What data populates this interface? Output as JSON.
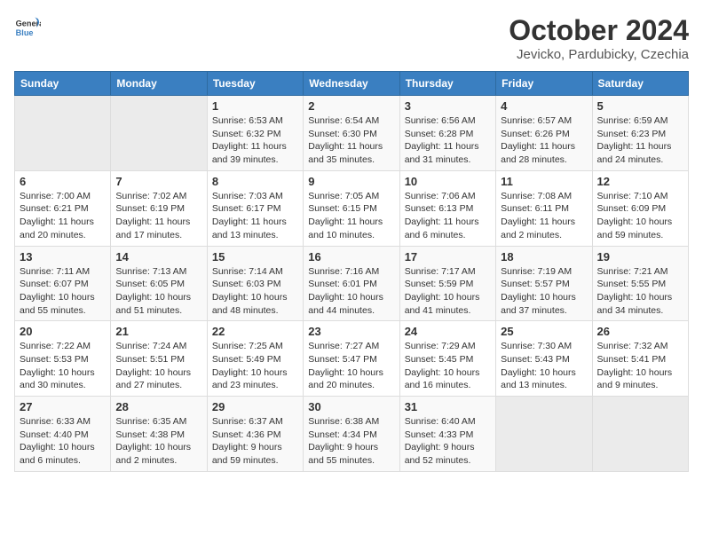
{
  "logo": {
    "line1": "General",
    "line2": "Blue"
  },
  "title": "October 2024",
  "subtitle": "Jevicko, Pardubicky, Czechia",
  "days_of_week": [
    "Sunday",
    "Monday",
    "Tuesday",
    "Wednesday",
    "Thursday",
    "Friday",
    "Saturday"
  ],
  "weeks": [
    [
      null,
      null,
      {
        "day": "1",
        "sunrise": "Sunrise: 6:53 AM",
        "sunset": "Sunset: 6:32 PM",
        "daylight": "Daylight: 11 hours and 39 minutes."
      },
      {
        "day": "2",
        "sunrise": "Sunrise: 6:54 AM",
        "sunset": "Sunset: 6:30 PM",
        "daylight": "Daylight: 11 hours and 35 minutes."
      },
      {
        "day": "3",
        "sunrise": "Sunrise: 6:56 AM",
        "sunset": "Sunset: 6:28 PM",
        "daylight": "Daylight: 11 hours and 31 minutes."
      },
      {
        "day": "4",
        "sunrise": "Sunrise: 6:57 AM",
        "sunset": "Sunset: 6:26 PM",
        "daylight": "Daylight: 11 hours and 28 minutes."
      },
      {
        "day": "5",
        "sunrise": "Sunrise: 6:59 AM",
        "sunset": "Sunset: 6:23 PM",
        "daylight": "Daylight: 11 hours and 24 minutes."
      }
    ],
    [
      {
        "day": "6",
        "sunrise": "Sunrise: 7:00 AM",
        "sunset": "Sunset: 6:21 PM",
        "daylight": "Daylight: 11 hours and 20 minutes."
      },
      {
        "day": "7",
        "sunrise": "Sunrise: 7:02 AM",
        "sunset": "Sunset: 6:19 PM",
        "daylight": "Daylight: 11 hours and 17 minutes."
      },
      {
        "day": "8",
        "sunrise": "Sunrise: 7:03 AM",
        "sunset": "Sunset: 6:17 PM",
        "daylight": "Daylight: 11 hours and 13 minutes."
      },
      {
        "day": "9",
        "sunrise": "Sunrise: 7:05 AM",
        "sunset": "Sunset: 6:15 PM",
        "daylight": "Daylight: 11 hours and 10 minutes."
      },
      {
        "day": "10",
        "sunrise": "Sunrise: 7:06 AM",
        "sunset": "Sunset: 6:13 PM",
        "daylight": "Daylight: 11 hours and 6 minutes."
      },
      {
        "day": "11",
        "sunrise": "Sunrise: 7:08 AM",
        "sunset": "Sunset: 6:11 PM",
        "daylight": "Daylight: 11 hours and 2 minutes."
      },
      {
        "day": "12",
        "sunrise": "Sunrise: 7:10 AM",
        "sunset": "Sunset: 6:09 PM",
        "daylight": "Daylight: 10 hours and 59 minutes."
      }
    ],
    [
      {
        "day": "13",
        "sunrise": "Sunrise: 7:11 AM",
        "sunset": "Sunset: 6:07 PM",
        "daylight": "Daylight: 10 hours and 55 minutes."
      },
      {
        "day": "14",
        "sunrise": "Sunrise: 7:13 AM",
        "sunset": "Sunset: 6:05 PM",
        "daylight": "Daylight: 10 hours and 51 minutes."
      },
      {
        "day": "15",
        "sunrise": "Sunrise: 7:14 AM",
        "sunset": "Sunset: 6:03 PM",
        "daylight": "Daylight: 10 hours and 48 minutes."
      },
      {
        "day": "16",
        "sunrise": "Sunrise: 7:16 AM",
        "sunset": "Sunset: 6:01 PM",
        "daylight": "Daylight: 10 hours and 44 minutes."
      },
      {
        "day": "17",
        "sunrise": "Sunrise: 7:17 AM",
        "sunset": "Sunset: 5:59 PM",
        "daylight": "Daylight: 10 hours and 41 minutes."
      },
      {
        "day": "18",
        "sunrise": "Sunrise: 7:19 AM",
        "sunset": "Sunset: 5:57 PM",
        "daylight": "Daylight: 10 hours and 37 minutes."
      },
      {
        "day": "19",
        "sunrise": "Sunrise: 7:21 AM",
        "sunset": "Sunset: 5:55 PM",
        "daylight": "Daylight: 10 hours and 34 minutes."
      }
    ],
    [
      {
        "day": "20",
        "sunrise": "Sunrise: 7:22 AM",
        "sunset": "Sunset: 5:53 PM",
        "daylight": "Daylight: 10 hours and 30 minutes."
      },
      {
        "day": "21",
        "sunrise": "Sunrise: 7:24 AM",
        "sunset": "Sunset: 5:51 PM",
        "daylight": "Daylight: 10 hours and 27 minutes."
      },
      {
        "day": "22",
        "sunrise": "Sunrise: 7:25 AM",
        "sunset": "Sunset: 5:49 PM",
        "daylight": "Daylight: 10 hours and 23 minutes."
      },
      {
        "day": "23",
        "sunrise": "Sunrise: 7:27 AM",
        "sunset": "Sunset: 5:47 PM",
        "daylight": "Daylight: 10 hours and 20 minutes."
      },
      {
        "day": "24",
        "sunrise": "Sunrise: 7:29 AM",
        "sunset": "Sunset: 5:45 PM",
        "daylight": "Daylight: 10 hours and 16 minutes."
      },
      {
        "day": "25",
        "sunrise": "Sunrise: 7:30 AM",
        "sunset": "Sunset: 5:43 PM",
        "daylight": "Daylight: 10 hours and 13 minutes."
      },
      {
        "day": "26",
        "sunrise": "Sunrise: 7:32 AM",
        "sunset": "Sunset: 5:41 PM",
        "daylight": "Daylight: 10 hours and 9 minutes."
      }
    ],
    [
      {
        "day": "27",
        "sunrise": "Sunrise: 6:33 AM",
        "sunset": "Sunset: 4:40 PM",
        "daylight": "Daylight: 10 hours and 6 minutes."
      },
      {
        "day": "28",
        "sunrise": "Sunrise: 6:35 AM",
        "sunset": "Sunset: 4:38 PM",
        "daylight": "Daylight: 10 hours and 2 minutes."
      },
      {
        "day": "29",
        "sunrise": "Sunrise: 6:37 AM",
        "sunset": "Sunset: 4:36 PM",
        "daylight": "Daylight: 9 hours and 59 minutes."
      },
      {
        "day": "30",
        "sunrise": "Sunrise: 6:38 AM",
        "sunset": "Sunset: 4:34 PM",
        "daylight": "Daylight: 9 hours and 55 minutes."
      },
      {
        "day": "31",
        "sunrise": "Sunrise: 6:40 AM",
        "sunset": "Sunset: 4:33 PM",
        "daylight": "Daylight: 9 hours and 52 minutes."
      },
      null,
      null
    ]
  ]
}
